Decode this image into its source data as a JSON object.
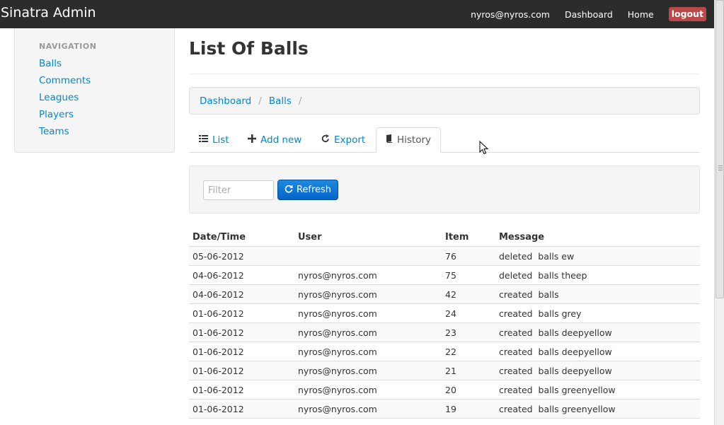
{
  "navbar": {
    "brand": "Sinatra Admin",
    "user_email": "nyros@nyros.com",
    "dashboard": "Dashboard",
    "home": "Home",
    "logout": "logout"
  },
  "sidebar": {
    "header": "NAVIGATION",
    "items": [
      {
        "label": "Balls"
      },
      {
        "label": "Comments"
      },
      {
        "label": "Leagues"
      },
      {
        "label": "Players"
      },
      {
        "label": "Teams"
      }
    ]
  },
  "main": {
    "title": "List Of Balls",
    "breadcrumb": [
      "Dashboard",
      "Balls"
    ],
    "breadcrumb_separator": "/",
    "tabs": [
      {
        "label": "List",
        "icon": "list-icon"
      },
      {
        "label": "Add new",
        "icon": "plus-icon"
      },
      {
        "label": "Export",
        "icon": "export-icon"
      },
      {
        "label": "History",
        "icon": "book-icon",
        "active": true
      }
    ],
    "filter": {
      "placeholder": "Filter",
      "refresh_label": "Refresh"
    },
    "table": {
      "headers": [
        "Date/Time",
        "User",
        "Item",
        "Message"
      ],
      "rows": [
        [
          "05-06-2012",
          "",
          "76",
          "deleted  balls ew"
        ],
        [
          "04-06-2012",
          "nyros@nyros.com",
          "75",
          "deleted  balls theep"
        ],
        [
          "04-06-2012",
          "nyros@nyros.com",
          "42",
          "created  balls"
        ],
        [
          "01-06-2012",
          "nyros@nyros.com",
          "24",
          "created  balls grey"
        ],
        [
          "01-06-2012",
          "nyros@nyros.com",
          "23",
          "created  balls deepyellow"
        ],
        [
          "01-06-2012",
          "nyros@nyros.com",
          "22",
          "created  balls deepyellow"
        ],
        [
          "01-06-2012",
          "nyros@nyros.com",
          "21",
          "created  balls deepyellow"
        ],
        [
          "01-06-2012",
          "nyros@nyros.com",
          "20",
          "created  balls greenyellow"
        ],
        [
          "01-06-2012",
          "nyros@nyros.com",
          "19",
          "created  balls greenyellow"
        ]
      ]
    }
  },
  "colors": {
    "navbar_bg": "#2c2c2c",
    "link": "#0088cc",
    "logout_bg": "#b94a48",
    "primary_button": "#0463c8"
  }
}
